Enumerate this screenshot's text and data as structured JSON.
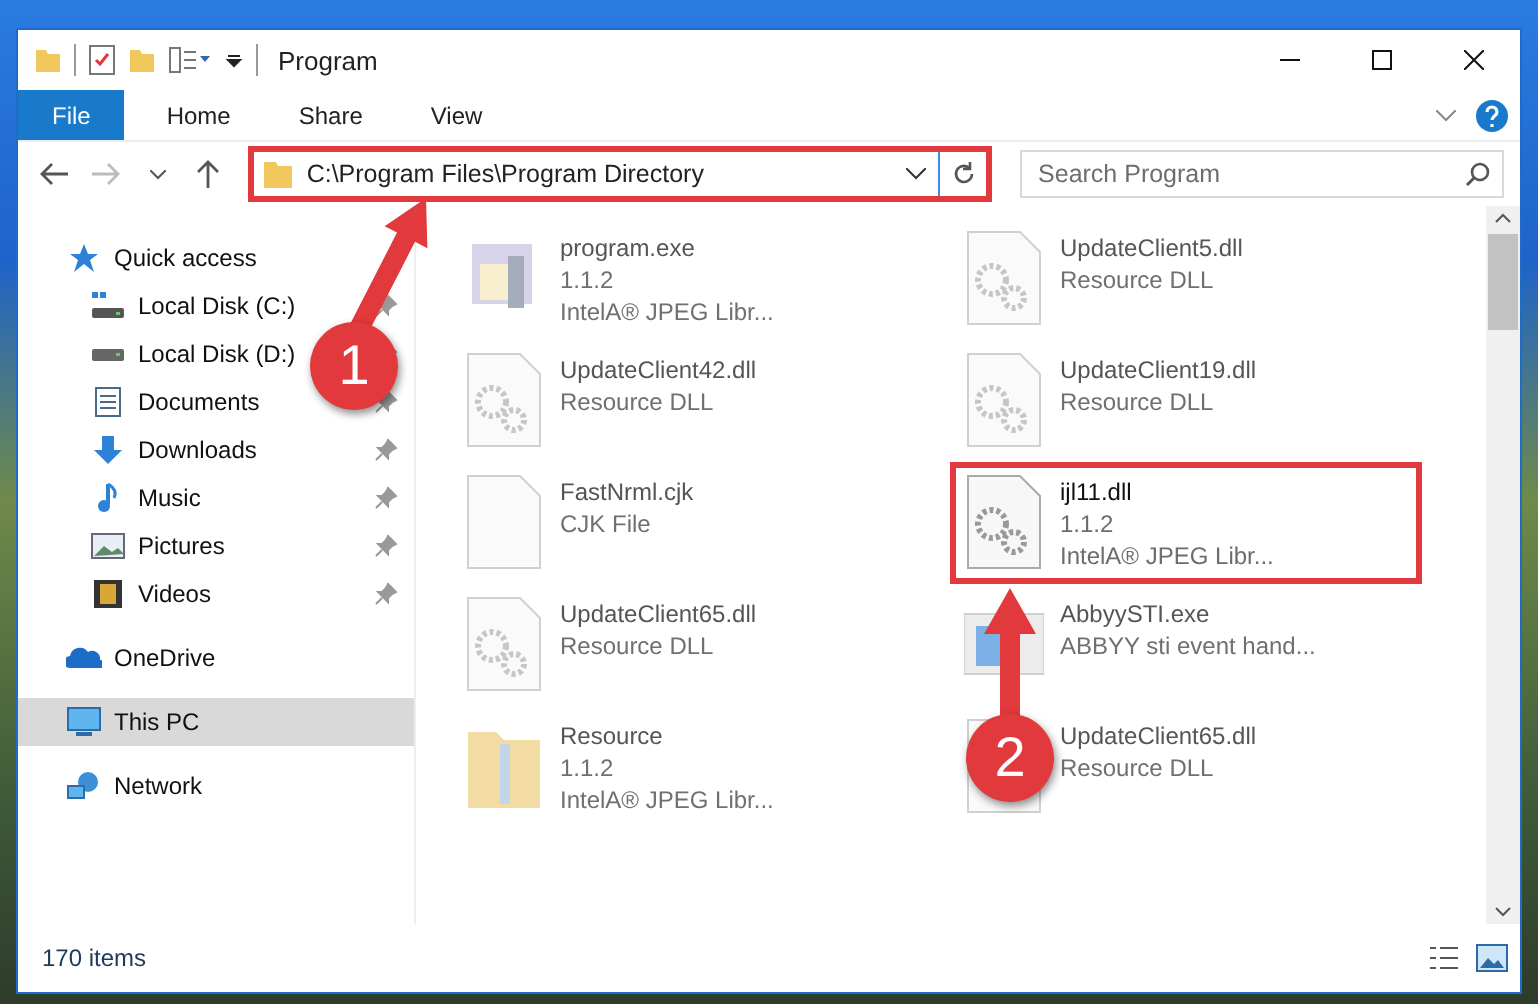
{
  "window": {
    "title": "Program"
  },
  "ribbon": {
    "tabs": [
      {
        "label": "File",
        "selected": true
      },
      {
        "label": "Home",
        "selected": false
      },
      {
        "label": "Share",
        "selected": false
      },
      {
        "label": "View",
        "selected": false
      }
    ]
  },
  "address": {
    "path": "C:\\Program Files\\Program Directory",
    "highlighted": true
  },
  "search": {
    "placeholder": "Search Program"
  },
  "sidebar": {
    "items": [
      {
        "label": "Quick access",
        "kind": "star",
        "selected": false,
        "children": [
          {
            "label": "Local Disk (C:)",
            "kind": "systemdisk",
            "selected": false,
            "pinned": true
          },
          {
            "label": "Local Disk (D:)",
            "kind": "disk",
            "selected": false,
            "pinned": true
          },
          {
            "label": "Documents",
            "kind": "documents",
            "selected": false,
            "pinned": true
          },
          {
            "label": "Downloads",
            "kind": "downloads",
            "selected": false,
            "pinned": true
          },
          {
            "label": "Music",
            "kind": "music",
            "selected": false,
            "pinned": true
          },
          {
            "label": "Pictures",
            "kind": "pictures",
            "selected": false,
            "pinned": true
          },
          {
            "label": "Videos",
            "kind": "videos",
            "selected": false,
            "pinned": true
          }
        ]
      },
      {
        "label": "OneDrive",
        "kind": "cloud",
        "selected": false
      },
      {
        "label": "This PC",
        "kind": "pc",
        "selected": true
      },
      {
        "label": "Network",
        "kind": "network",
        "selected": false
      }
    ]
  },
  "files": [
    {
      "name": "program.exe",
      "kind": "exe",
      "lines": [
        "1.1.2",
        "IntelA® JPEG Libr..."
      ],
      "blurred": true,
      "highlighted": false
    },
    {
      "name": "UpdateClient5.dll",
      "kind": "dll",
      "lines": [
        "Resource DLL"
      ],
      "blurred": true,
      "highlighted": false
    },
    {
      "name": "UpdateClient42.dll",
      "kind": "dll",
      "lines": [
        "Resource DLL"
      ],
      "blurred": true,
      "highlighted": false
    },
    {
      "name": "UpdateClient19.dll",
      "kind": "dll",
      "lines": [
        "Resource DLL"
      ],
      "blurred": true,
      "highlighted": false
    },
    {
      "name": "FastNrml.cjk",
      "kind": "file",
      "lines": [
        "CJK File"
      ],
      "blurred": true,
      "highlighted": false
    },
    {
      "name": "ijl11.dll",
      "kind": "gears",
      "lines": [
        "1.1.2",
        "IntelA® JPEG Libr..."
      ],
      "blurred": false,
      "highlighted": true
    },
    {
      "name": "UpdateClient65.dll",
      "kind": "dll",
      "lines": [
        "Resource DLL"
      ],
      "blurred": true,
      "highlighted": false
    },
    {
      "name": "AbbyySTI.exe",
      "kind": "app",
      "lines": [
        "ABBYY sti event hand..."
      ],
      "blurred": true,
      "highlighted": false
    },
    {
      "name": "Resource",
      "kind": "folder",
      "lines": [
        "1.1.2",
        "IntelA® JPEG Libr..."
      ],
      "blurred": true,
      "highlighted": false
    },
    {
      "name": "UpdateClient65.dll",
      "kind": "dll",
      "lines": [
        "Resource DLL"
      ],
      "blurred": true,
      "highlighted": false
    }
  ],
  "status_bar": {
    "count": "170 items"
  },
  "annotations": [
    {
      "number": "1"
    },
    {
      "number": "2"
    }
  ]
}
